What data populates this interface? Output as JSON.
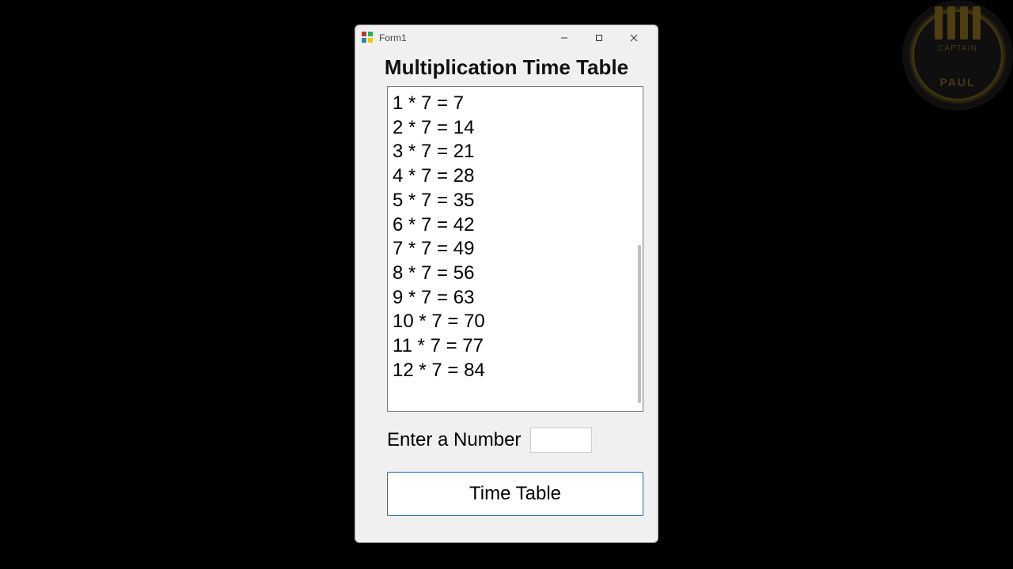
{
  "window": {
    "title": "Form1"
  },
  "header": "Multiplication Time Table",
  "list_items": [
    "1 * 7 = 7",
    "2 * 7 = 14",
    "3 * 7 = 21",
    "4 * 7 = 28",
    "5 * 7 = 35",
    "6 * 7 = 42",
    "7 * 7 = 49",
    "8 * 7 = 56",
    "9 * 7 = 63",
    "10 * 7 = 70",
    "11 * 7 = 77",
    "12 * 7 = 84"
  ],
  "prompt": {
    "label": "Enter a Number",
    "value": ""
  },
  "button": {
    "label": "Time Table"
  },
  "watermark": {
    "line1": "CAPTAIN",
    "line2": "PAUL"
  }
}
